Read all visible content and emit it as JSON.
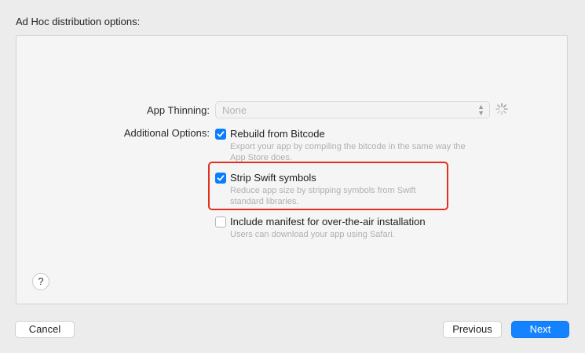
{
  "heading": "Ad Hoc distribution options:",
  "app_thinning": {
    "label": "App Thinning:",
    "value": "None",
    "chevron_icon": "up-down-chevron-icon",
    "spinner_icon": "loading-spinner-icon"
  },
  "additional_options": {
    "label": "Additional Options:",
    "items": [
      {
        "title": "Rebuild from Bitcode",
        "desc_line1": "Export your app by compiling the bitcode in the same way the",
        "desc_line2": "App Store does.",
        "checked": true
      },
      {
        "title": "Strip Swift symbols",
        "desc_line1": "Reduce app size by stripping symbols from Swift",
        "desc_line2": "standard libraries.",
        "checked": true
      },
      {
        "title": "Include manifest for over-the-air installation",
        "desc_line1": "Users can download your app using Safari.",
        "desc_line2": "",
        "checked": false
      }
    ]
  },
  "help": "?",
  "buttons": {
    "cancel": "Cancel",
    "previous": "Previous",
    "next": "Next"
  },
  "colors": {
    "accent": "#0a7cff",
    "highlight": "#e0311f"
  }
}
